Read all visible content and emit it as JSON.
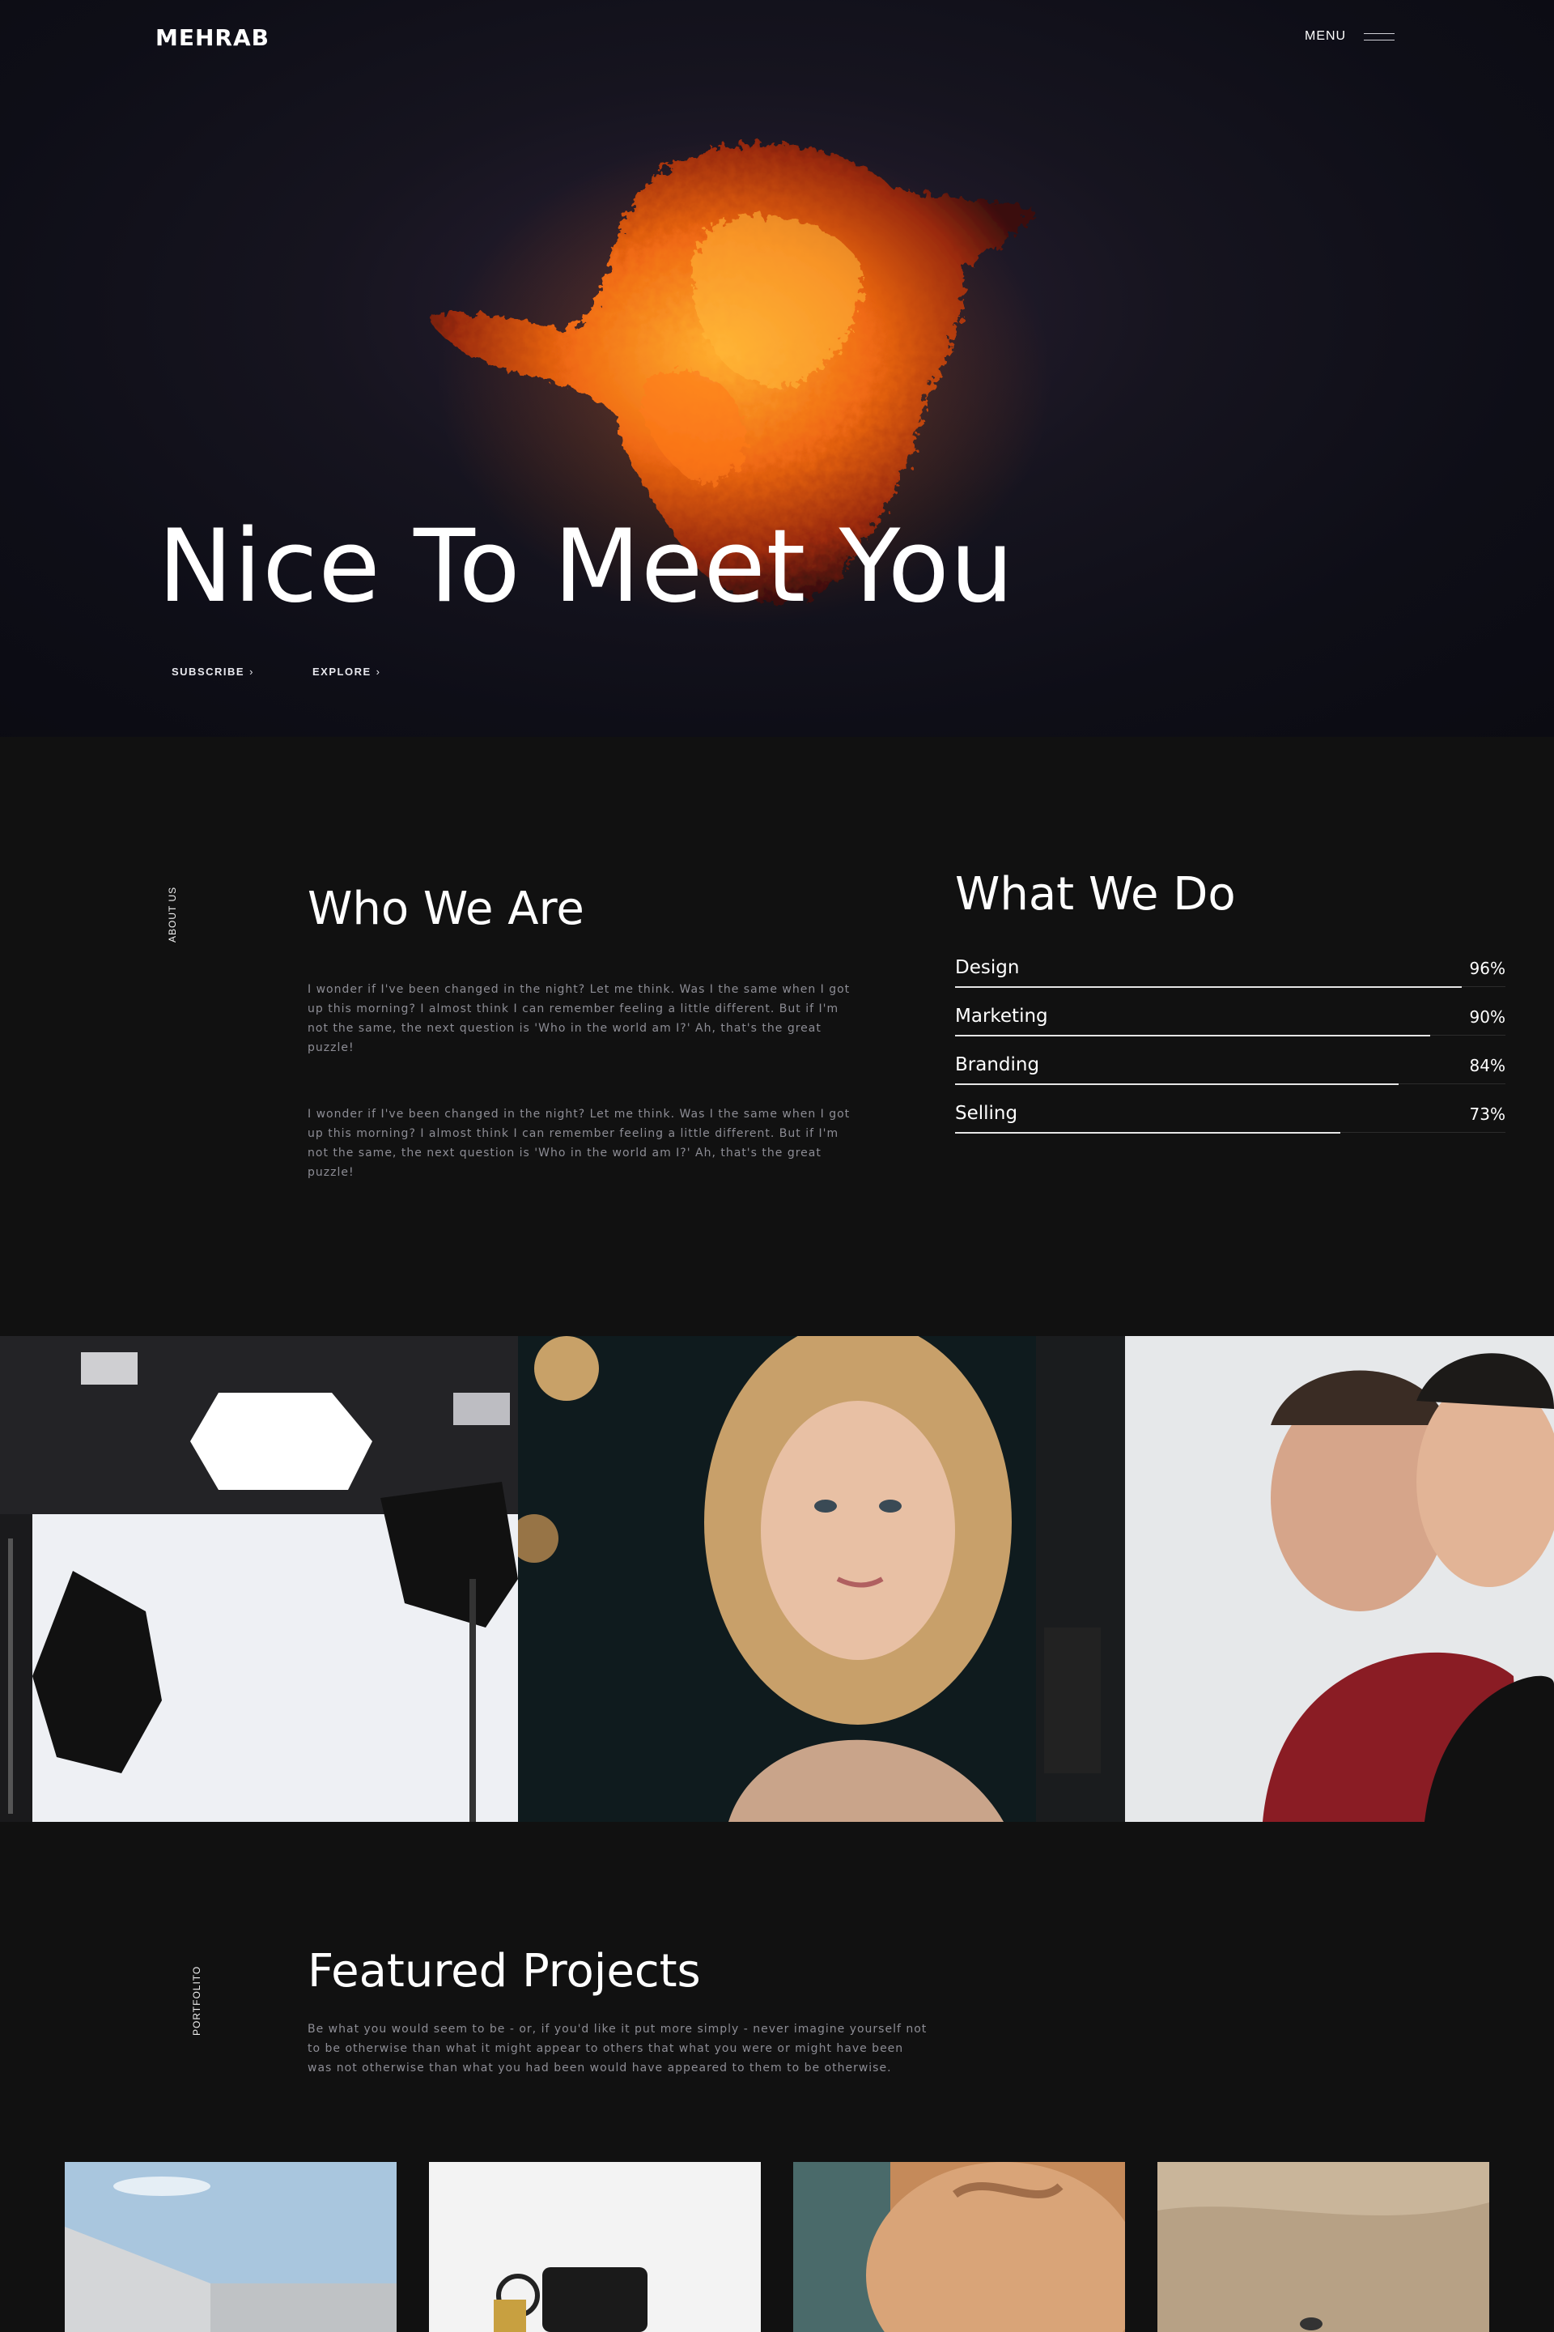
{
  "header": {
    "logo": "MEHRAB",
    "menu_label": "MENU"
  },
  "hero": {
    "title": "Nice To Meet You",
    "links": [
      "SUBSCRIBE",
      "EXPLORE"
    ],
    "chevron": "›"
  },
  "about": {
    "section_label": "ABOUT US",
    "title": "Who We Are",
    "paragraphs": [
      "I wonder if I've been changed in the night? Let me think. Was I the same when I got up this morning? I almost think I can remember feeling a little different. But if I'm not the same, the next question is 'Who in the world am I?' Ah, that's the great puzzle!",
      "I wonder if I've been changed in the night? Let me think. Was I the same when I got up this morning? I almost think I can remember feeling a little different. But if I'm not the same, the next question is 'Who in the world am I?' Ah, that's the great puzzle!"
    ]
  },
  "services": {
    "title": "What We Do",
    "skills": [
      {
        "name": "Design",
        "value": "96%",
        "level": 0.96
      },
      {
        "name": "Marketing",
        "value": "90%",
        "level": 0.9
      },
      {
        "name": "Branding",
        "value": "84%",
        "level": 0.84
      },
      {
        "name": "Selling",
        "value": "73%",
        "level": 0.73
      }
    ]
  },
  "portfolio": {
    "section_label": "PORTFOLITO",
    "title": "Featured Projects",
    "description": "Be what you would seem to be - or, if you'd like it put more simply - never imagine yourself not to be otherwise than what it might appear to others that what you were or might have been was not otherwise than what you had been would have appeared to them to be otherwise."
  },
  "colors": {
    "background": "#111111",
    "hero_background": "#0e0e17",
    "accent_fire": "#ff6a10",
    "text_muted": "#8d8d95"
  }
}
